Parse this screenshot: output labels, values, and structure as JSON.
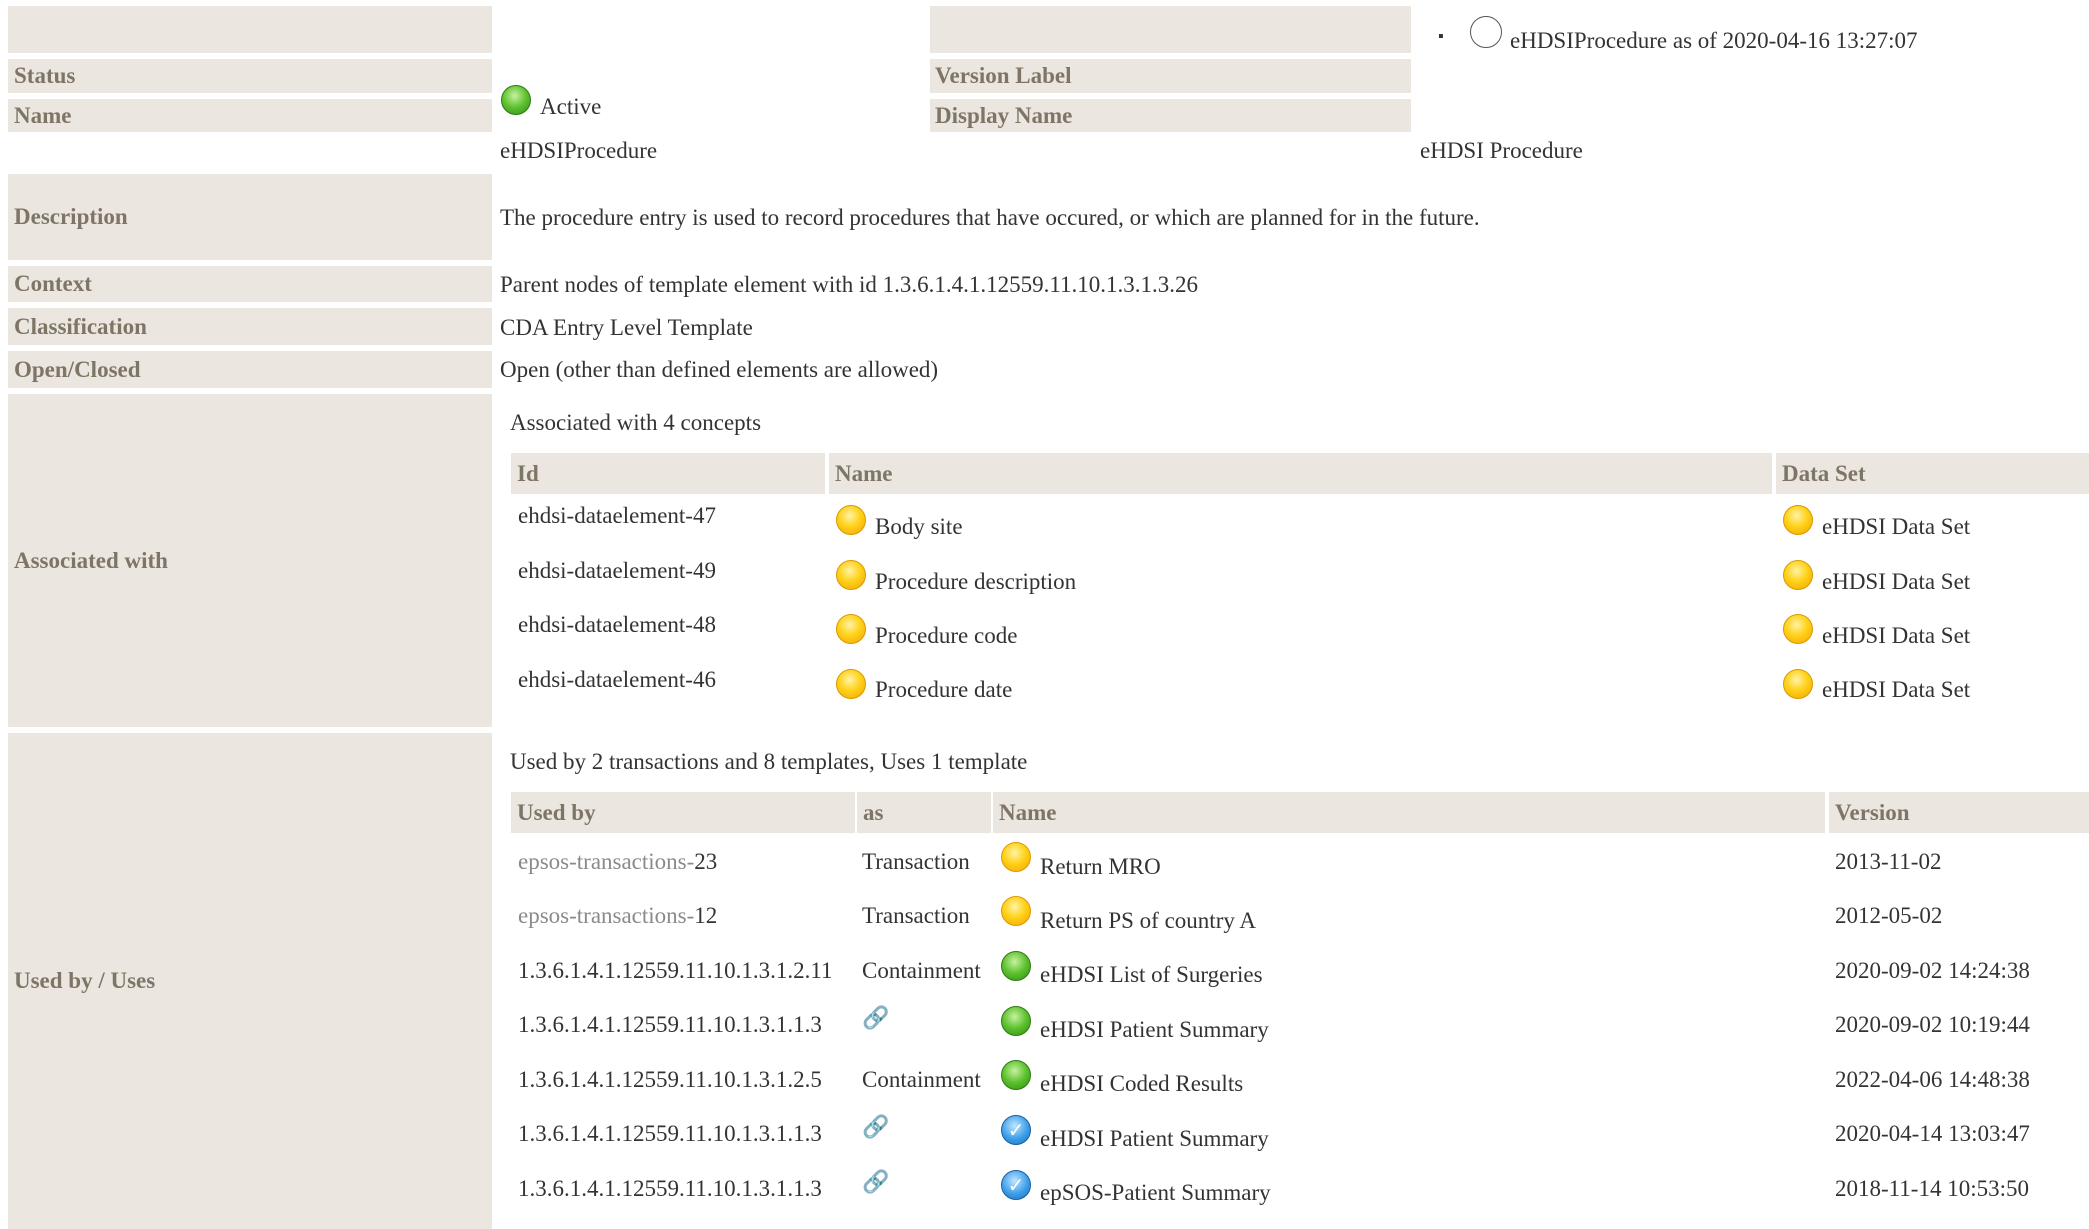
{
  "header": {
    "bullet": "▪",
    "version_link": "eHDSIProcedure as of 2020-04-16 13:27:07"
  },
  "labels": {
    "status": "Status",
    "version_label": "Version Label",
    "name": "Name",
    "display_name": "Display Name",
    "description": "Description",
    "context": "Context",
    "classification": "Classification",
    "open_closed": "Open/Closed",
    "associated_with": "Associated with",
    "used_by_uses": "Used by / Uses"
  },
  "values": {
    "status": "Active",
    "version_label": "",
    "name": "eHDSIProcedure",
    "display_name": "eHDSI Procedure",
    "description": "The procedure entry is used to record procedures that have occured, or which are planned for in the future.",
    "context": "Parent nodes of template element with id 1.3.6.1.4.1.12559.11.10.1.3.1.3.26",
    "classification": "CDA Entry Level Template",
    "open_closed": "Open (other than defined elements are allowed)"
  },
  "associations": {
    "summary": "Associated with 4 concepts",
    "headers": {
      "id": "Id",
      "name": "Name",
      "dataset": "Data Set"
    },
    "rows": [
      {
        "id": "ehdsi-dataelement-47",
        "name": "Body site",
        "dataset": "eHDSI Data Set"
      },
      {
        "id": "ehdsi-dataelement-49",
        "name": "Procedure description",
        "dataset": "eHDSI Data Set"
      },
      {
        "id": "ehdsi-dataelement-48",
        "name": "Procedure code",
        "dataset": "eHDSI Data Set"
      },
      {
        "id": "ehdsi-dataelement-46",
        "name": "Procedure date",
        "dataset": "eHDSI Data Set"
      }
    ]
  },
  "usage": {
    "summary": "Used by 2 transactions and 8 templates, Uses 1 template",
    "headers": {
      "used_by": "Used by",
      "as": "as",
      "name": "Name",
      "version": "Version"
    },
    "rows": [
      {
        "prefix": "epsos-transactions-",
        "id": "23",
        "as": "Transaction",
        "name": "Return MRO",
        "version": "2013-11-02",
        "status": "yellow"
      },
      {
        "prefix": "epsos-transactions-",
        "id": "12",
        "as": "Transaction",
        "name": "Return PS of country A",
        "version": "2012-05-02",
        "status": "yellow"
      },
      {
        "prefix": "",
        "id": "1.3.6.1.4.1.12559.11.10.1.3.1.2.11",
        "as": "Containment",
        "name": "eHDSI List of Surgeries",
        "version": "2020-09-02 14:24:38",
        "status": "green"
      },
      {
        "prefix": "",
        "id": "1.3.6.1.4.1.12559.11.10.1.3.1.1.3",
        "as": "",
        "name": "eHDSI Patient Summary",
        "version": "2020-09-02 10:19:44",
        "status": "green"
      },
      {
        "prefix": "",
        "id": "1.3.6.1.4.1.12559.11.10.1.3.1.2.5",
        "as": "Containment",
        "name": "eHDSI Coded Results",
        "version": "2022-04-06 14:48:38",
        "status": "green"
      },
      {
        "prefix": "",
        "id": "1.3.6.1.4.1.12559.11.10.1.3.1.1.3",
        "as": "",
        "name": "eHDSI Patient Summary",
        "version": "2020-04-14 13:03:47",
        "status": "blue"
      },
      {
        "prefix": "",
        "id": "1.3.6.1.4.1.12559.11.10.1.3.1.1.3",
        "as": "",
        "name": "epSOS-Patient Summary",
        "version": "2018-11-14 10:53:50",
        "status": "blue"
      }
    ]
  },
  "colors": {
    "label_bg": "#ebe7e0",
    "label_text": "#7f7566",
    "status_draft": "#ffd21a",
    "status_active": "#5cc02d",
    "status_final": "#3c9ee8",
    "link_icon": "#e07a1a"
  },
  "icons": {
    "draft": "yellow-status-dot-icon",
    "active": "green-status-dot-icon",
    "final": "blue-check-status-icon",
    "link": "chain-link-icon",
    "version": "empty-circle-icon"
  }
}
